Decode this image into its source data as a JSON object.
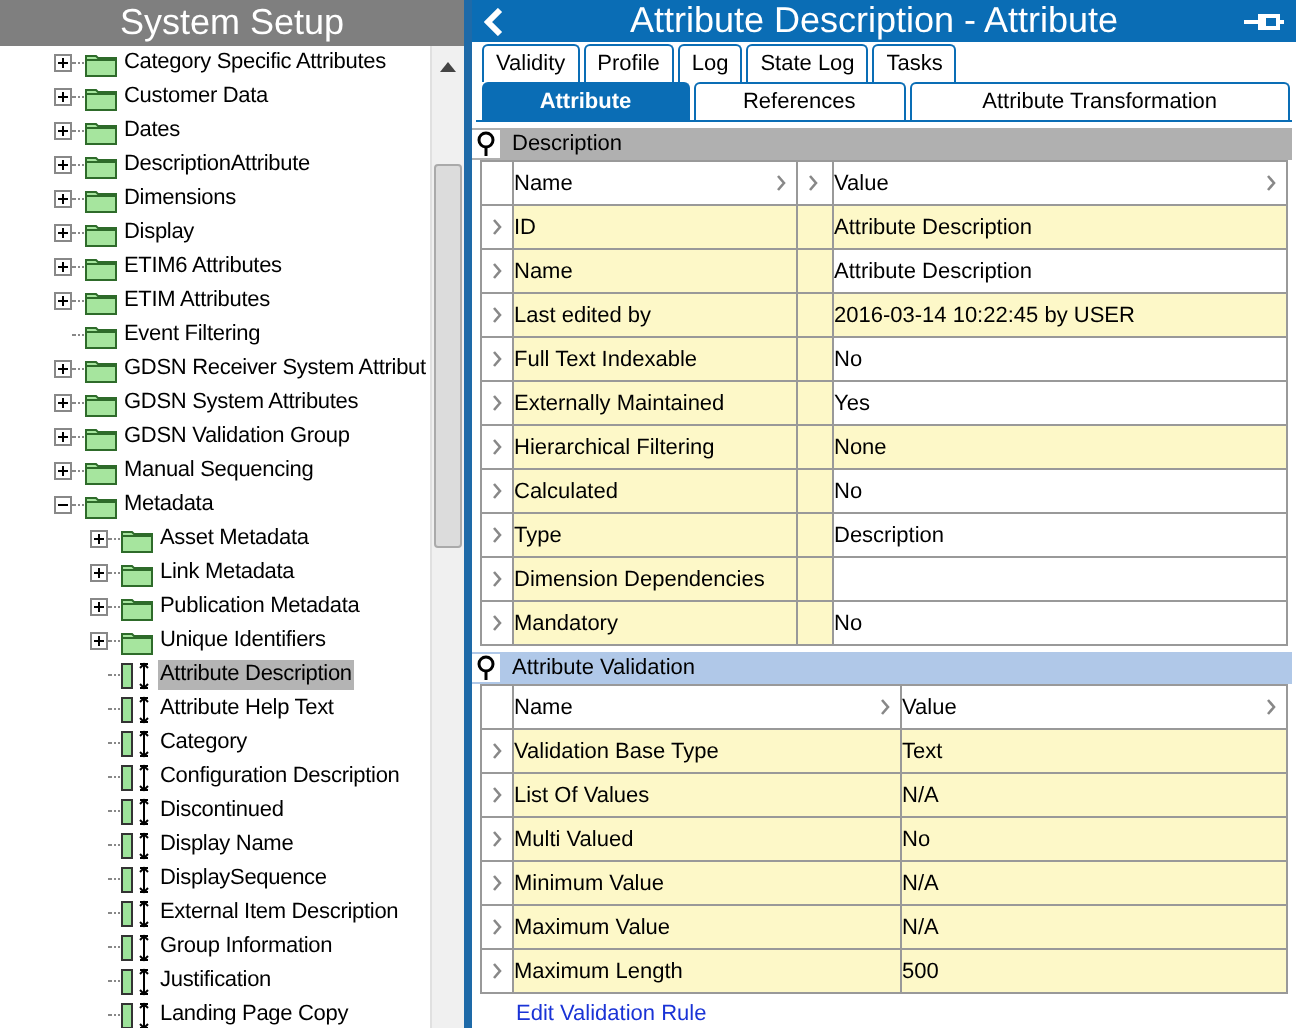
{
  "sidebar": {
    "title": "System Setup",
    "tree": [
      {
        "label": "Category Specific Attributes",
        "kind": "group",
        "expanded": false,
        "selected": false
      },
      {
        "label": "Customer Data",
        "kind": "group",
        "expanded": false,
        "selected": false
      },
      {
        "label": "Dates",
        "kind": "group",
        "expanded": false,
        "selected": false
      },
      {
        "label": "DescriptionAttribute",
        "kind": "group",
        "expanded": false,
        "selected": false
      },
      {
        "label": "Dimensions",
        "kind": "group",
        "expanded": false,
        "selected": false
      },
      {
        "label": "Display",
        "kind": "group",
        "expanded": false,
        "selected": false
      },
      {
        "label": "ETIM6 Attributes",
        "kind": "group",
        "expanded": false,
        "selected": false
      },
      {
        "label": "ETIM Attributes",
        "kind": "group",
        "expanded": false,
        "selected": false
      },
      {
        "label": "Event Filtering",
        "kind": "folder",
        "selected": false
      },
      {
        "label": "GDSN Receiver System Attribut",
        "kind": "group",
        "expanded": false,
        "selected": false
      },
      {
        "label": "GDSN System Attributes",
        "kind": "group",
        "expanded": false,
        "selected": false
      },
      {
        "label": "GDSN Validation Group",
        "kind": "group",
        "expanded": false,
        "selected": false
      },
      {
        "label": "Manual Sequencing",
        "kind": "group",
        "expanded": false,
        "selected": false
      },
      {
        "label": "Metadata",
        "kind": "group",
        "expanded": true,
        "selected": false,
        "children": [
          {
            "label": "Asset Metadata",
            "kind": "group",
            "expanded": false,
            "selected": false
          },
          {
            "label": "Link Metadata",
            "kind": "group",
            "expanded": false,
            "selected": false
          },
          {
            "label": "Publication Metadata",
            "kind": "group",
            "expanded": false,
            "selected": false
          },
          {
            "label": "Unique Identifiers",
            "kind": "group",
            "expanded": false,
            "selected": false
          },
          {
            "label": "Attribute Description",
            "kind": "attribute",
            "selected": true
          },
          {
            "label": "Attribute Help Text",
            "kind": "attribute",
            "selected": false
          },
          {
            "label": "Category",
            "kind": "attribute",
            "selected": false
          },
          {
            "label": "Configuration Description",
            "kind": "attribute",
            "selected": false
          },
          {
            "label": "Discontinued",
            "kind": "attribute",
            "selected": false
          },
          {
            "label": "Display Name",
            "kind": "attribute",
            "selected": false
          },
          {
            "label": "DisplaySequence",
            "kind": "attribute",
            "selected": false
          },
          {
            "label": "External Item Description",
            "kind": "attribute",
            "selected": false
          },
          {
            "label": "Group Information",
            "kind": "attribute",
            "selected": false
          },
          {
            "label": "Justification",
            "kind": "attribute",
            "selected": false
          },
          {
            "label": "Landing Page Copy",
            "kind": "attribute",
            "selected": false
          }
        ]
      }
    ]
  },
  "detail": {
    "title": "Attribute Description - Attribute",
    "tabs_top": [
      {
        "label": "Validity",
        "selected": false
      },
      {
        "label": "Profile",
        "selected": false
      },
      {
        "label": "Log",
        "selected": false
      },
      {
        "label": "State Log",
        "selected": false
      },
      {
        "label": "Tasks",
        "selected": false
      }
    ],
    "tabs_bottom": [
      {
        "label": "Attribute",
        "selected": true
      },
      {
        "label": "References",
        "selected": false
      },
      {
        "label": "Attribute Transformation",
        "selected": false
      }
    ],
    "sections": [
      {
        "title": "Description",
        "kind": "properties",
        "focused": false,
        "columns": [
          "Name",
          "Value"
        ],
        "rows": [
          {
            "name": "ID",
            "value": "Attribute Description",
            "shaded": true
          },
          {
            "name": "Name",
            "value": "Attribute Description",
            "shaded": false
          },
          {
            "name": "Last edited by",
            "value": "2016-03-14 10:22:45 by USER",
            "shaded": true
          },
          {
            "name": "Full Text Indexable",
            "value": "No",
            "shaded": false
          },
          {
            "name": "Externally Maintained",
            "value": "Yes",
            "shaded": false
          },
          {
            "name": "Hierarchical Filtering",
            "value": "None",
            "shaded": true
          },
          {
            "name": "Calculated",
            "value": "No",
            "shaded": false
          },
          {
            "name": "Type",
            "value": "Description",
            "shaded": false
          },
          {
            "name": "Dimension Dependencies",
            "shaded": false
          },
          {
            "name": "Mandatory",
            "value": "No",
            "shaded": false
          }
        ]
      },
      {
        "title": "Attribute Validation",
        "kind": "validation",
        "focused": true,
        "columns": [
          "Name",
          "Value"
        ],
        "rows": [
          {
            "name": "Validation Base Type",
            "value": "Text",
            "shaded": true
          },
          {
            "name": "List Of Values",
            "value": "N/A",
            "shaded": true
          },
          {
            "name": "Multi Valued",
            "value": "No",
            "shaded": true
          },
          {
            "name": "Minimum Value",
            "value": "N/A",
            "shaded": true
          },
          {
            "name": "Maximum Value",
            "value": "N/A",
            "shaded": true
          },
          {
            "name": "Maximum Length",
            "value": "500",
            "shaded": true
          }
        ]
      }
    ],
    "link": "Edit Validation Rule"
  }
}
